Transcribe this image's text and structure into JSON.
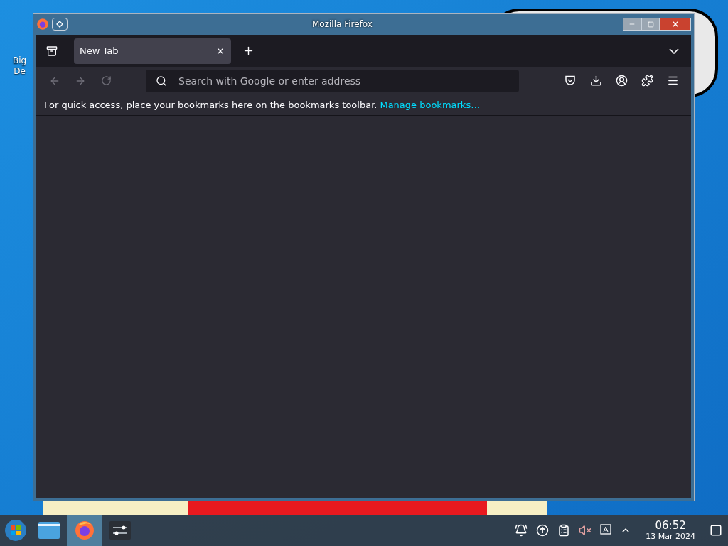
{
  "desktop": {
    "icon_label": [
      "Big",
      "De"
    ]
  },
  "window": {
    "title": "Mozilla Firefox"
  },
  "tabs": [
    {
      "label": "New Tab",
      "selected": true
    }
  ],
  "address_bar": {
    "placeholder": "Search with Google or enter address"
  },
  "bookmarks_bar": {
    "message": "For quick access, place your bookmarks here on the bookmarks toolbar.",
    "link": "Manage bookmarks…"
  },
  "taskbar": {
    "apps": [
      {
        "kind": "files",
        "active": false
      },
      {
        "kind": "browser",
        "active": true
      },
      {
        "kind": "settings",
        "active": false
      }
    ],
    "tray": {
      "volume_muted": true
    },
    "time": "06:52",
    "date": "13 Mar 2024"
  }
}
